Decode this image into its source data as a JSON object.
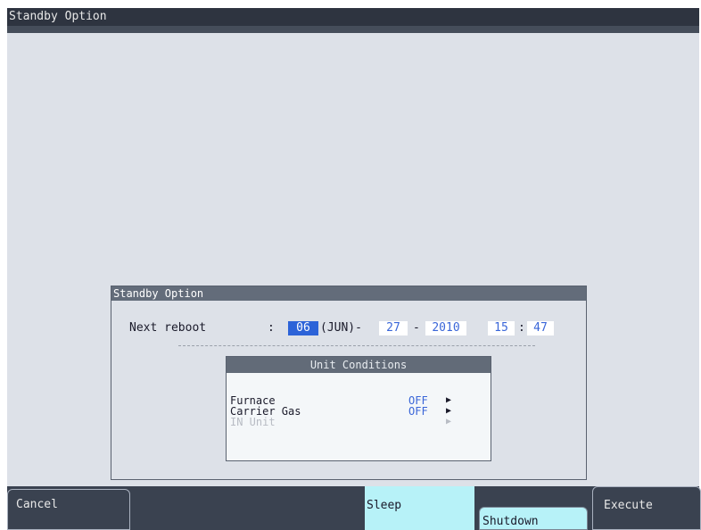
{
  "window": {
    "title": "Standby Option"
  },
  "dialog": {
    "title": "Standby Option",
    "next_reboot_label": "Next reboot",
    "colon": ":",
    "month": "06",
    "month_name": "(JUN)-",
    "day": "27",
    "sep": "-",
    "year": "2010",
    "hour": "15",
    "time_sep": ":",
    "minute": "47"
  },
  "unit_conditions": {
    "title": "Unit Conditions",
    "rows": [
      {
        "name": "Furnace",
        "state": "OFF",
        "arrow": "▶",
        "enabled": true
      },
      {
        "name": "Carrier Gas",
        "state": "OFF",
        "arrow": "▶",
        "enabled": true
      },
      {
        "name": "IN Unit",
        "state": "",
        "arrow": "▶",
        "enabled": false
      }
    ]
  },
  "buttons": {
    "cancel": "Cancel",
    "sleep": "Sleep",
    "shutdown": "Shutdown",
    "execute": "Execute"
  },
  "colors": {
    "selected_field": "#2c63d8",
    "value_text": "#3a66d8",
    "active_button": "#b7f2f8"
  }
}
